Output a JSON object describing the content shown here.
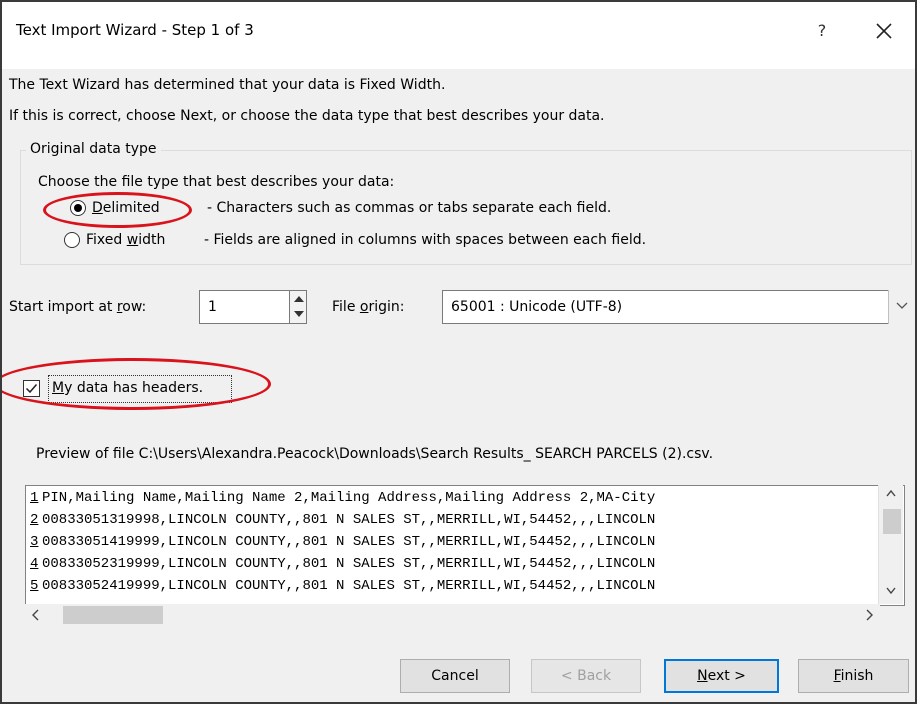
{
  "window": {
    "title": "Text Import Wizard - Step 1 of 3",
    "help_label": "?"
  },
  "intro": {
    "line1": "The Text Wizard has determined that your data is Fixed Width.",
    "line2": "If this is correct, choose Next, or choose the data type that best describes your data."
  },
  "original_data_type": {
    "group_label": "Original data type",
    "prompt": "Choose the file type that best describes your data:",
    "options": [
      {
        "label_pre": "",
        "label_key": "D",
        "label_post": "elimited",
        "description": "- Characters such as commas or tabs separate each field.",
        "selected": true
      },
      {
        "label_pre": "Fixed ",
        "label_key": "w",
        "label_post": "idth",
        "description": "- Fields are aligned in columns with spaces between each field.",
        "selected": false
      }
    ]
  },
  "start_row": {
    "label_pre": "Start import at ",
    "label_key": "r",
    "label_post": "ow:",
    "value": "1"
  },
  "file_origin": {
    "label_pre": "File ",
    "label_key": "o",
    "label_post": "rigin:",
    "value": "65001 : Unicode (UTF-8)"
  },
  "headers_checkbox": {
    "label_pre": "",
    "label_key": "M",
    "label_post": "y data has headers.",
    "checked": true
  },
  "preview": {
    "label": "Preview of file C:\\Users\\Alexandra.Peacock\\Downloads\\Search Results_ SEARCH PARCELS (2).csv.",
    "rows": [
      {
        "num": "1",
        "text": "PIN,Mailing Name,Mailing Name 2,Mailing Address,Mailing Address 2,MA-City"
      },
      {
        "num": "2",
        "text": "00833051319998,LINCOLN COUNTY,,801 N SALES ST,,MERRILL,WI,54452,,,LINCOLN"
      },
      {
        "num": "3",
        "text": "00833051419999,LINCOLN COUNTY,,801 N SALES ST,,MERRILL,WI,54452,,,LINCOLN"
      },
      {
        "num": "4",
        "text": "00833052319999,LINCOLN COUNTY,,801 N SALES ST,,MERRILL,WI,54452,,,LINCOLN"
      },
      {
        "num": "5",
        "text": "00833052419999,LINCOLN COUNTY,,801 N SALES ST,,MERRILL,WI,54452,,,LINCOLN"
      }
    ]
  },
  "buttons": {
    "cancel": "Cancel",
    "back": "< Back",
    "next_key": "N",
    "next_post": "ext >",
    "finish_key": "F",
    "finish_post": "inish"
  },
  "colors": {
    "callout": "#d9121b",
    "default_button_border": "#0078d7"
  },
  "icons": [
    "close-icon",
    "spin-up-icon",
    "spin-down-icon",
    "chevron-down-icon",
    "checkmark-icon",
    "scroll-up-icon",
    "scroll-down-icon",
    "scroll-left-icon",
    "scroll-right-icon"
  ]
}
